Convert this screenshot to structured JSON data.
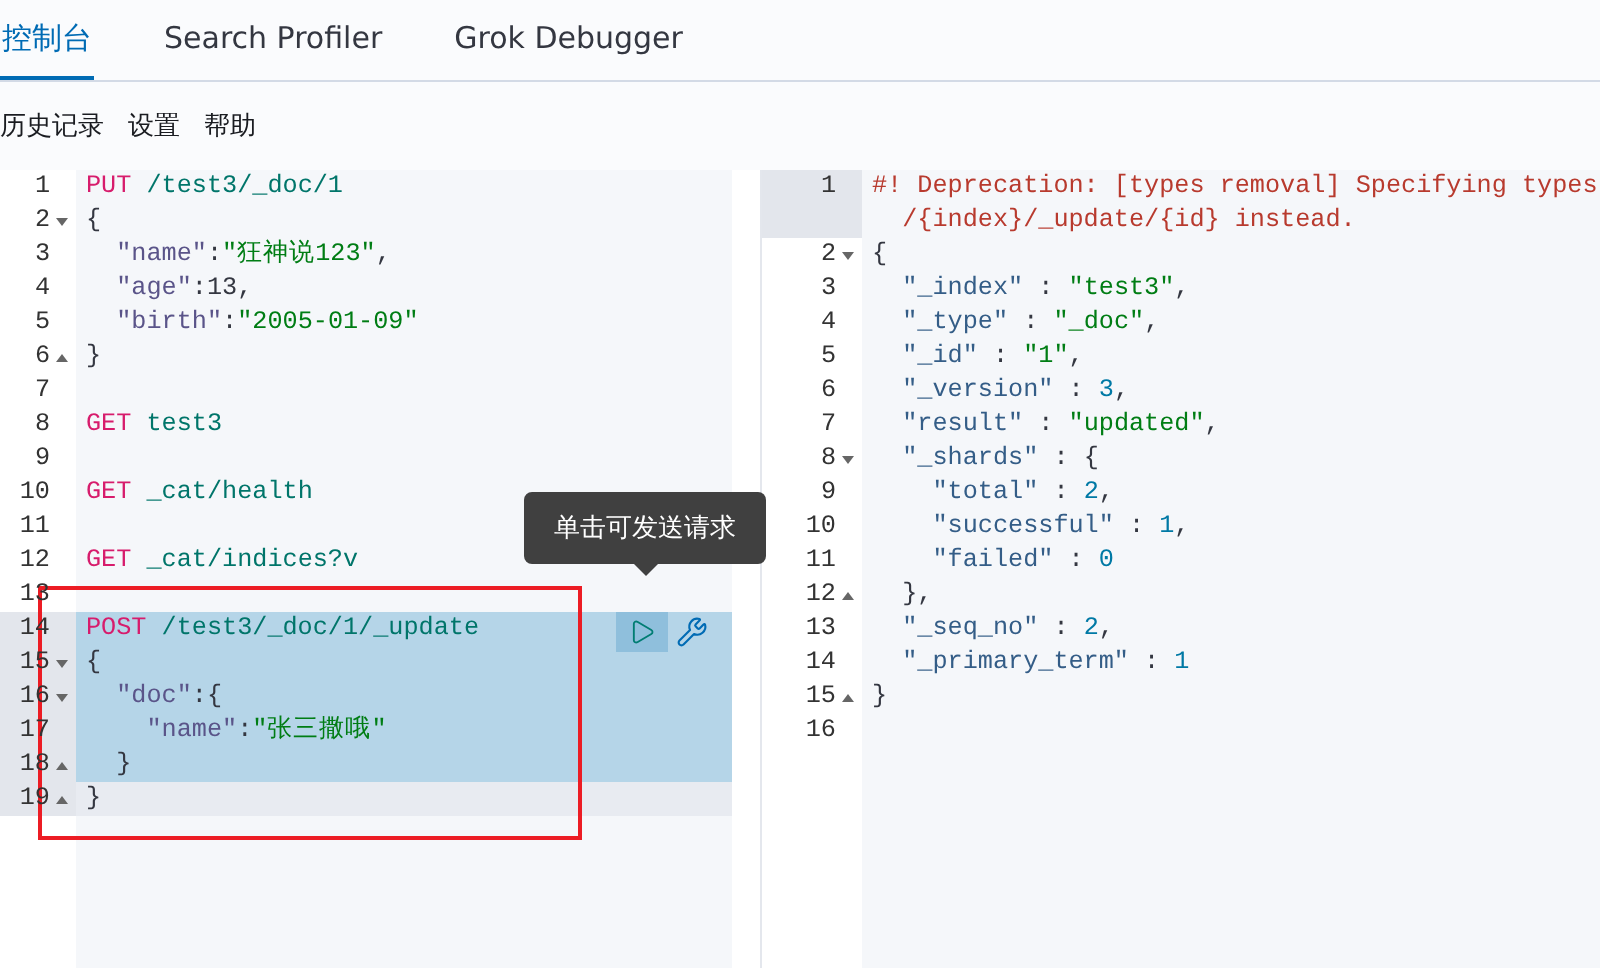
{
  "tabs": [
    {
      "label": "控制台",
      "selected": true
    },
    {
      "label": "Search Profiler",
      "selected": false
    },
    {
      "label": "Grok Debugger",
      "selected": false
    }
  ],
  "toolbar": [
    "历史记录",
    "设置",
    "帮助"
  ],
  "request_editor": {
    "lines": [
      {
        "number": "1",
        "selected": false,
        "active": false,
        "fold_start": false,
        "fold_end": false,
        "tokens": [
          {
            "kind": "method",
            "text": "PUT"
          },
          {
            "kind": "url",
            "text": " /test3/_doc/1"
          }
        ]
      },
      {
        "number": "2",
        "selected": false,
        "active": false,
        "fold_start": true,
        "fold_end": false,
        "tokens": [
          {
            "kind": "punct",
            "text": "{"
          }
        ]
      },
      {
        "number": "3",
        "selected": false,
        "active": false,
        "fold_start": false,
        "fold_end": false,
        "tokens": [
          {
            "kind": "key",
            "text": "  \"name\""
          },
          {
            "kind": "punct",
            "text": ":"
          },
          {
            "kind": "string",
            "text": "\"狂神说123\""
          },
          {
            "kind": "punct",
            "text": ","
          }
        ]
      },
      {
        "number": "4",
        "selected": false,
        "active": false,
        "fold_start": false,
        "fold_end": false,
        "tokens": [
          {
            "kind": "key",
            "text": "  \"age\""
          },
          {
            "kind": "punct",
            "text": ":13,"
          }
        ]
      },
      {
        "number": "5",
        "selected": false,
        "active": false,
        "fold_start": false,
        "fold_end": false,
        "tokens": [
          {
            "kind": "key",
            "text": "  \"birth\""
          },
          {
            "kind": "punct",
            "text": ":"
          },
          {
            "kind": "string",
            "text": "\"2005-01-09\""
          }
        ]
      },
      {
        "number": "6",
        "selected": false,
        "active": false,
        "fold_start": false,
        "fold_end": true,
        "tokens": [
          {
            "kind": "punct",
            "text": "}"
          }
        ]
      },
      {
        "number": "7",
        "selected": false,
        "active": false,
        "fold_start": false,
        "fold_end": false
      },
      {
        "number": "8",
        "selected": false,
        "active": false,
        "fold_start": false,
        "fold_end": false,
        "tokens": [
          {
            "kind": "method",
            "text": "GET"
          },
          {
            "kind": "url",
            "text": " test3"
          }
        ]
      },
      {
        "number": "9",
        "selected": false,
        "active": false,
        "fold_start": false,
        "fold_end": false
      },
      {
        "number": "10",
        "selected": false,
        "active": false,
        "fold_start": false,
        "fold_end": false,
        "tokens": [
          {
            "kind": "method",
            "text": "GET"
          },
          {
            "kind": "url",
            "text": " _cat/health"
          }
        ]
      },
      {
        "number": "11",
        "selected": false,
        "active": false,
        "fold_start": false,
        "fold_end": false
      },
      {
        "number": "12",
        "selected": false,
        "active": false,
        "fold_start": false,
        "fold_end": false,
        "tokens": [
          {
            "kind": "method",
            "text": "GET"
          },
          {
            "kind": "url",
            "text": " _cat/indices?v"
          }
        ]
      },
      {
        "number": "13",
        "selected": false,
        "active": false,
        "fold_start": false,
        "fold_end": false
      },
      {
        "number": "14",
        "selected": true,
        "active": false,
        "fold_start": false,
        "fold_end": false,
        "tokens": [
          {
            "kind": "method",
            "text": "POST"
          },
          {
            "kind": "url",
            "text": " /test3/_doc/1/_update"
          }
        ]
      },
      {
        "number": "15",
        "selected": true,
        "active": false,
        "fold_start": true,
        "fold_end": false,
        "tokens": [
          {
            "kind": "punct",
            "text": "{"
          }
        ]
      },
      {
        "number": "16",
        "selected": true,
        "active": false,
        "fold_start": true,
        "fold_end": false,
        "tokens": [
          {
            "kind": "key",
            "text": "  \"doc\""
          },
          {
            "kind": "punct",
            "text": ":{"
          }
        ]
      },
      {
        "number": "17",
        "selected": true,
        "active": false,
        "fold_start": false,
        "fold_end": false,
        "tokens": [
          {
            "kind": "key",
            "text": "    \"name\""
          },
          {
            "kind": "punct",
            "text": ":"
          },
          {
            "kind": "string",
            "text": "\"张三撒哦\""
          }
        ]
      },
      {
        "number": "18",
        "selected": true,
        "active": false,
        "fold_start": false,
        "fold_end": true,
        "tokens": [
          {
            "kind": "punct",
            "text": "  }"
          }
        ]
      },
      {
        "number": "19",
        "selected": false,
        "active": true,
        "fold_start": false,
        "fold_end": true,
        "tokens": [
          {
            "kind": "punct",
            "text": "}"
          }
        ]
      }
    ],
    "tooltip": "单击可发送请求"
  },
  "response_viewer": {
    "lines": [
      {
        "number": "1",
        "selected": false,
        "active": true,
        "fold_start": false,
        "fold_end": false,
        "tokens": [
          {
            "kind": "comment",
            "text": "#! Deprecation: [types removal] Specifying types"
          }
        ],
        "continuation": "  /{index}/_update/{id} instead."
      },
      {
        "number": "2",
        "selected": false,
        "active": false,
        "fold_start": true,
        "fold_end": false,
        "tokens": [
          {
            "kind": "punct",
            "text": "{"
          }
        ]
      },
      {
        "number": "3",
        "selected": false,
        "active": false,
        "fold_start": false,
        "fold_end": false,
        "tokens": [
          {
            "kind": "rkey",
            "text": "  \"_index\""
          },
          {
            "kind": "punct",
            "text": " : "
          },
          {
            "kind": "string",
            "text": "\"test3\""
          },
          {
            "kind": "punct",
            "text": ","
          }
        ]
      },
      {
        "number": "4",
        "selected": false,
        "active": false,
        "fold_start": false,
        "fold_end": false,
        "tokens": [
          {
            "kind": "rkey",
            "text": "  \"_type\""
          },
          {
            "kind": "punct",
            "text": " : "
          },
          {
            "kind": "string",
            "text": "\"_doc\""
          },
          {
            "kind": "punct",
            "text": ","
          }
        ]
      },
      {
        "number": "5",
        "selected": false,
        "active": false,
        "fold_start": false,
        "fold_end": false,
        "tokens": [
          {
            "kind": "rkey",
            "text": "  \"_id\""
          },
          {
            "kind": "punct",
            "text": " : "
          },
          {
            "kind": "string",
            "text": "\"1\""
          },
          {
            "kind": "punct",
            "text": ","
          }
        ]
      },
      {
        "number": "6",
        "selected": false,
        "active": false,
        "fold_start": false,
        "fold_end": false,
        "tokens": [
          {
            "kind": "rkey",
            "text": "  \"_version\""
          },
          {
            "kind": "punct",
            "text": " : "
          },
          {
            "kind": "number",
            "text": "3"
          },
          {
            "kind": "punct",
            "text": ","
          }
        ]
      },
      {
        "number": "7",
        "selected": false,
        "active": false,
        "fold_start": false,
        "fold_end": false,
        "tokens": [
          {
            "kind": "rkey",
            "text": "  \"result\""
          },
          {
            "kind": "punct",
            "text": " : "
          },
          {
            "kind": "string",
            "text": "\"updated\""
          },
          {
            "kind": "punct",
            "text": ","
          }
        ]
      },
      {
        "number": "8",
        "selected": false,
        "active": false,
        "fold_start": true,
        "fold_end": false,
        "tokens": [
          {
            "kind": "rkey",
            "text": "  \"_shards\""
          },
          {
            "kind": "punct",
            "text": " : {"
          }
        ]
      },
      {
        "number": "9",
        "selected": false,
        "active": false,
        "fold_start": false,
        "fold_end": false,
        "tokens": [
          {
            "kind": "rkey",
            "text": "    \"total\""
          },
          {
            "kind": "punct",
            "text": " : "
          },
          {
            "kind": "number",
            "text": "2"
          },
          {
            "kind": "punct",
            "text": ","
          }
        ]
      },
      {
        "number": "10",
        "selected": false,
        "active": false,
        "fold_start": false,
        "fold_end": false,
        "tokens": [
          {
            "kind": "rkey",
            "text": "    \"successful\""
          },
          {
            "kind": "punct",
            "text": " : "
          },
          {
            "kind": "number",
            "text": "1"
          },
          {
            "kind": "punct",
            "text": ","
          }
        ]
      },
      {
        "number": "11",
        "selected": false,
        "active": false,
        "fold_start": false,
        "fold_end": false,
        "tokens": [
          {
            "kind": "rkey",
            "text": "    \"failed\""
          },
          {
            "kind": "punct",
            "text": " : "
          },
          {
            "kind": "number",
            "text": "0"
          }
        ]
      },
      {
        "number": "12",
        "selected": false,
        "active": false,
        "fold_start": false,
        "fold_end": true,
        "tokens": [
          {
            "kind": "punct",
            "text": "  },"
          }
        ]
      },
      {
        "number": "13",
        "selected": false,
        "active": false,
        "fold_start": false,
        "fold_end": false,
        "tokens": [
          {
            "kind": "rkey",
            "text": "  \"_seq_no\""
          },
          {
            "kind": "punct",
            "text": " : "
          },
          {
            "kind": "number",
            "text": "2"
          },
          {
            "kind": "punct",
            "text": ","
          }
        ]
      },
      {
        "number": "14",
        "selected": false,
        "active": false,
        "fold_start": false,
        "fold_end": false,
        "tokens": [
          {
            "kind": "rkey",
            "text": "  \"_primary_term\""
          },
          {
            "kind": "punct",
            "text": " : "
          },
          {
            "kind": "number",
            "text": "1"
          }
        ]
      },
      {
        "number": "15",
        "selected": false,
        "active": false,
        "fold_start": false,
        "fold_end": true,
        "tokens": [
          {
            "kind": "punct",
            "text": "}"
          }
        ]
      },
      {
        "number": "16",
        "selected": false,
        "active": false,
        "fold_start": false,
        "fold_end": false
      }
    ]
  }
}
